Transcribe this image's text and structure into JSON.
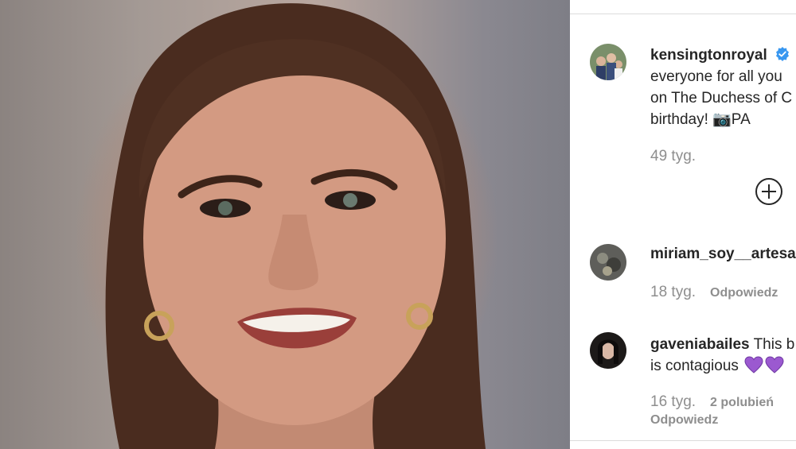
{
  "post": {
    "author": "kensingtonroyal",
    "caption_lines": [
      "everyone for all you",
      "on The Duchess of C",
      "birthday! 📷PA"
    ],
    "time": "49 tyg.",
    "load_more_icon": "plus-circle-icon",
    "verified_color": "#3897f0"
  },
  "comments": [
    {
      "username": "miriam_soy__artesa",
      "text": "",
      "time": "18 tyg.",
      "reply": "Odpowiedz"
    },
    {
      "username": "gaveniabailes",
      "text_first": "This b",
      "text_second": "is contagious",
      "time": "16 tyg.",
      "likes": "2 polubień",
      "reply": "Odpowiedz",
      "heart_color": "#9b59d0"
    }
  ]
}
